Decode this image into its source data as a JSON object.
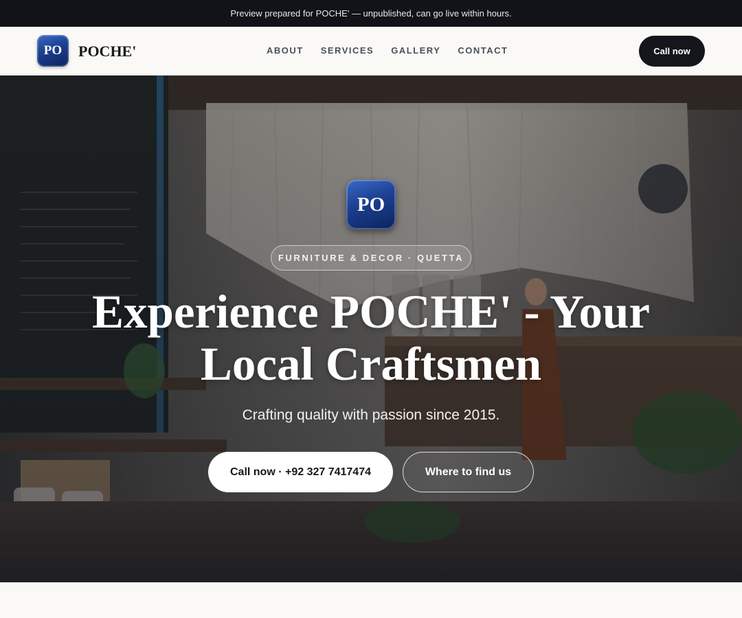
{
  "preview_banner": "Preview prepared for POCHE' — unpublished, can go live within hours.",
  "brand": {
    "badge_text": "PO",
    "name": "POCHE'"
  },
  "nav": {
    "links": [
      "ABOUT",
      "SERVICES",
      "GALLERY",
      "CONTACT"
    ],
    "call_label": "Call now"
  },
  "hero": {
    "badge_text": "PO",
    "tag": "FURNITURE & DECOR · QUETTA",
    "title": "Experience POCHE' - Your Local Craftsmen",
    "subtitle": "Crafting quality with passion since 2015.",
    "call_label": "Call now · +92 327 7417474",
    "find_label": "Where to find us"
  },
  "colors": {
    "topbar": "#111318",
    "accent_dark": "#14161c",
    "badge_blue": "#1c3f8f",
    "page_bg": "#faf9f6"
  }
}
